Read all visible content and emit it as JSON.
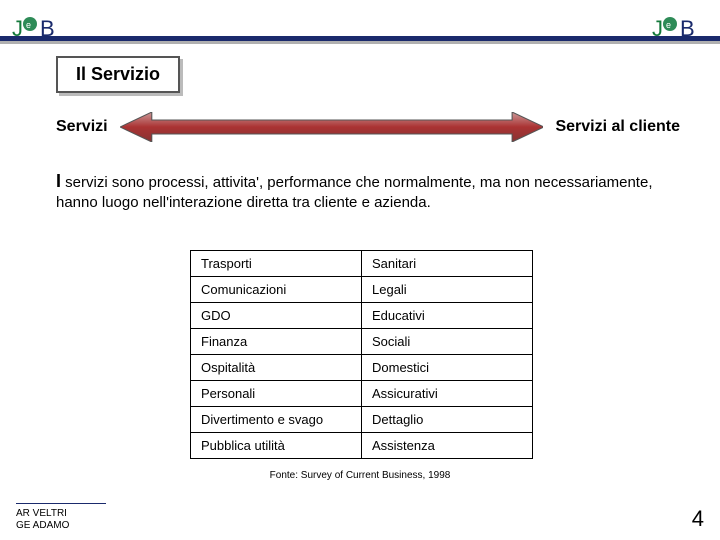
{
  "logo_text": "J•B",
  "title": "Il Servizio",
  "arrow_left": "Servizi",
  "arrow_right": "Servizi al cliente",
  "definition_lead": "I",
  "definition_rest": " servizi sono processi, attivita', performance che normalmente, ma non necessariamente, hanno luogo nell'interazione diretta tra cliente e azienda.",
  "table": {
    "rows": [
      [
        "Trasporti",
        "Sanitari"
      ],
      [
        "Comunicazioni",
        "Legali"
      ],
      [
        "GDO",
        "Educativi"
      ],
      [
        "Finanza",
        "Sociali"
      ],
      [
        "Ospitalità",
        "Domestici"
      ],
      [
        "Personali",
        "Assicurativi"
      ],
      [
        "Divertimento e svago",
        "Dettaglio"
      ],
      [
        "Pubblica utilità",
        "Assistenza"
      ]
    ]
  },
  "source": "Fonte: Survey of Current Business, 1998",
  "author1": "AR VELTRI",
  "author2": "GE ADAMO",
  "page": "4"
}
